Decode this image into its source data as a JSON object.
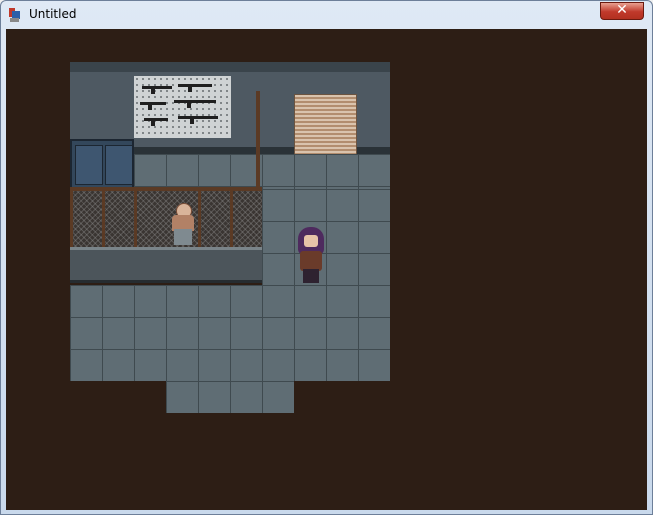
{
  "window": {
    "title": "Untitled",
    "close_label": "✕"
  },
  "icons": {
    "app": "rpg-maker-icon",
    "close": "close-icon"
  },
  "scene": {
    "background_color": "#2d1e15",
    "floor_color": "#5f6d74",
    "wall_color": "#4e5962"
  }
}
